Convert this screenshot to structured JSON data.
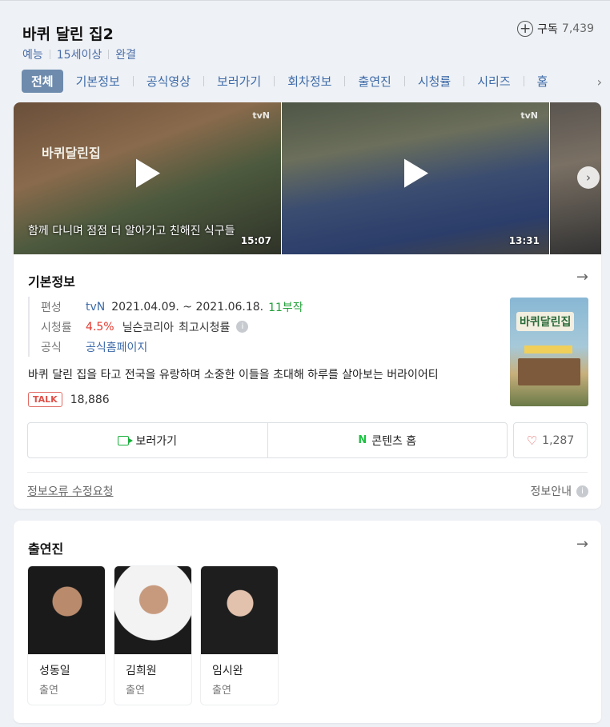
{
  "header": {
    "title": "바퀴 달린 집2",
    "meta": [
      "예능",
      "15세이상",
      "완결"
    ],
    "subscribe_label": "구독",
    "subscribe_count": "7,439"
  },
  "tabs": [
    "전체",
    "기본정보",
    "공식영상",
    "보러가기",
    "회차정보",
    "출연진",
    "시청률",
    "시리즈",
    "홈"
  ],
  "clips": [
    {
      "caption": "함께 다니며 점점 더 알아가고 친해진 식구들",
      "duration": "15:07",
      "logo": "tvN",
      "mark": "바퀴달린집"
    },
    {
      "caption": "",
      "duration": "13:31",
      "logo": "tvN",
      "mark": ""
    }
  ],
  "basic_info": {
    "section_title": "기본정보",
    "broadcast_label": "편성",
    "channel": "tvN",
    "period": "2021.04.09. ~ 2021.06.18.",
    "episodes": "11부작",
    "rating_label": "시청률",
    "rating_value": "4.5%",
    "rating_source": "닐슨코리아",
    "rating_type": "최고시청률",
    "official_label": "공식",
    "official_link": "공식홈페이지",
    "description": "바퀴 달린 집을 타고 전국을 유랑하며 소중한 이들을 초대해 하루를 살아보는 버라이어티",
    "talk_badge": "TALK",
    "talk_count": "18,886",
    "poster_title": "바퀴달린집"
  },
  "actions": {
    "watch_label": "보러가기",
    "contents_home_label": "콘텐츠 홈",
    "like_count": "1,287"
  },
  "footer": {
    "report_label": "정보오류 수정요청",
    "guide_label": "정보안내"
  },
  "cast_section": {
    "title": "출연진",
    "members": [
      {
        "name": "성동일",
        "role": "출연"
      },
      {
        "name": "김희원",
        "role": "출연"
      },
      {
        "name": "임시완",
        "role": "출연"
      }
    ]
  },
  "colors": {
    "accent_blue": "#3d6aa8",
    "active_tab": "#6e8bad",
    "green": "#23a03b",
    "red": "#e2372d"
  }
}
